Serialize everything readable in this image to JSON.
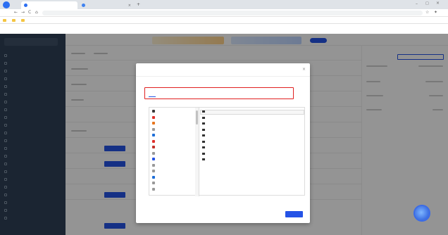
{
  "browser": {
    "tabs": [
      {
        "label": "",
        "favicon_color": "#2b6ef2"
      },
      {
        "label": "",
        "favicon_color": "#3f82f0"
      }
    ],
    "url": "",
    "bookmarks": [
      "",
      "",
      ""
    ]
  },
  "sidebar": {
    "items": [
      "",
      "",
      "",
      "",
      "",
      "",
      "",
      "",
      "",
      "",
      "",
      "",
      "",
      "",
      "",
      "",
      "",
      "",
      "",
      "",
      "",
      ""
    ]
  },
  "dialog": {
    "title": "",
    "tabs": [
      "",
      "",
      "",
      "",
      "",
      "",
      ""
    ],
    "active_tab": 0,
    "left_list_title": "",
    "right_list_title": "",
    "left_items": [
      {
        "label": "",
        "icon_color": "#3a3a3a"
      },
      {
        "label": "",
        "icon_color": "#e0302b"
      },
      {
        "label": "",
        "icon_color": "#e8761e"
      },
      {
        "label": "",
        "icon_color": "#999999"
      },
      {
        "label": "",
        "icon_color": "#1e6fd8"
      },
      {
        "label": "",
        "icon_color": "#e0302b"
      },
      {
        "label": "",
        "icon_color": "#c0332b"
      },
      {
        "label": "",
        "icon_color": "#999999"
      },
      {
        "label": "",
        "icon_color": "#2553e6"
      },
      {
        "label": "",
        "icon_color": "#999999"
      },
      {
        "label": "",
        "icon_color": "#999999"
      },
      {
        "label": "",
        "icon_color": "#1e6fd8"
      },
      {
        "label": "",
        "icon_color": "#999999"
      },
      {
        "label": "",
        "icon_color": "#999999"
      }
    ],
    "right_items": [
      "",
      "",
      "",
      "",
      "",
      "",
      "",
      "",
      ""
    ],
    "cancel_label": "",
    "confirm_label": ""
  },
  "colors": {
    "accent": "#2553e6",
    "highlight_border": "#e02020",
    "sidebar_bg": "#2f4056"
  }
}
